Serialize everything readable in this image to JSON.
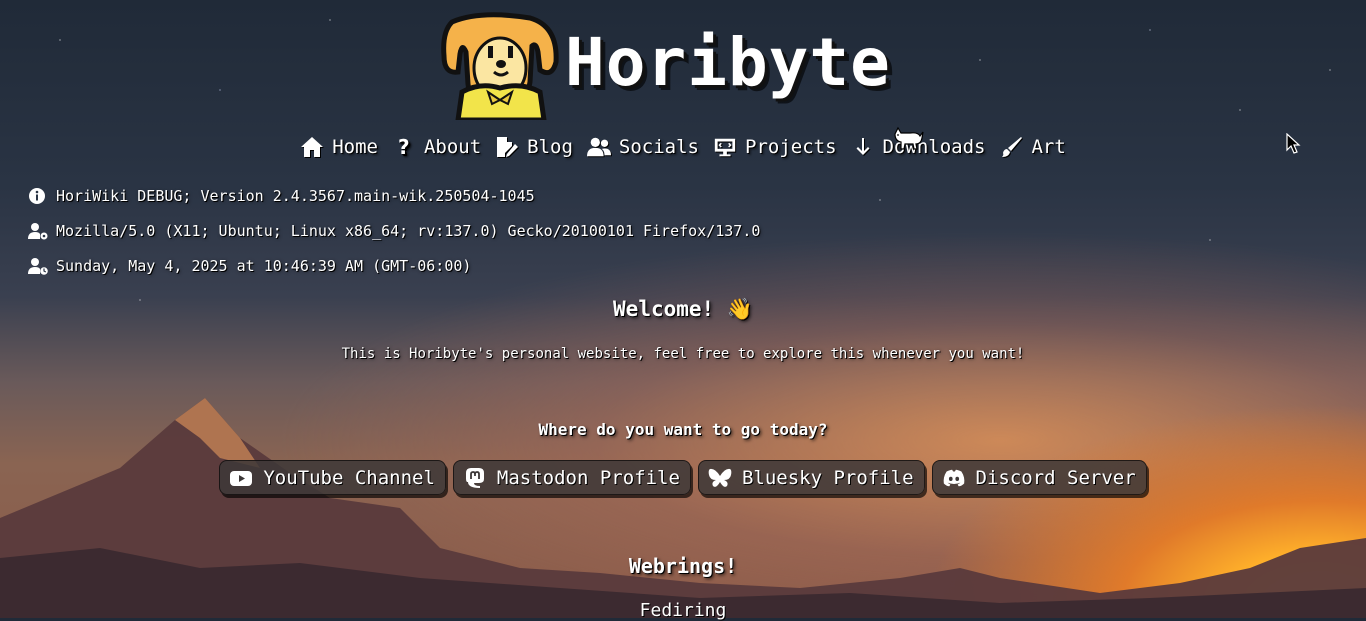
{
  "site": {
    "title": "Horibyte"
  },
  "nav": {
    "home": "Home",
    "about": "About",
    "blog": "Blog",
    "socials": "Socials",
    "projects": "Projects",
    "downloads": "Downloads",
    "art": "Art"
  },
  "info": {
    "version": "HoriWiki DEBUG; Version 2.4.3567.main-wik.250504-1045",
    "user_agent": "Mozilla/5.0 (X11; Ubuntu; Linux x86_64; rv:137.0) Gecko/20100101 Firefox/137.0",
    "datetime": "Sunday, May 4, 2025 at 10:46:39 AM (GMT-06:00)"
  },
  "main": {
    "welcome": "Welcome! 👋",
    "intro": "This is Horibyte's personal website, feel free to explore this whenever you want!",
    "where": "Where do you want to go today?",
    "links": {
      "youtube": "YouTube Channel",
      "mastodon": "Mastodon Profile",
      "bluesky": "Bluesky Profile",
      "discord": "Discord Server"
    },
    "webrings_title": "Webrings!",
    "fediring": "Fediring"
  },
  "icons": [
    "home-icon",
    "question-icon",
    "blog-icon",
    "users-icon",
    "projects-icon",
    "download-icon",
    "brush-icon",
    "info-icon",
    "user-gear-icon",
    "user-clock-icon",
    "youtube-icon",
    "mastodon-icon",
    "bluesky-icon",
    "discord-icon"
  ]
}
